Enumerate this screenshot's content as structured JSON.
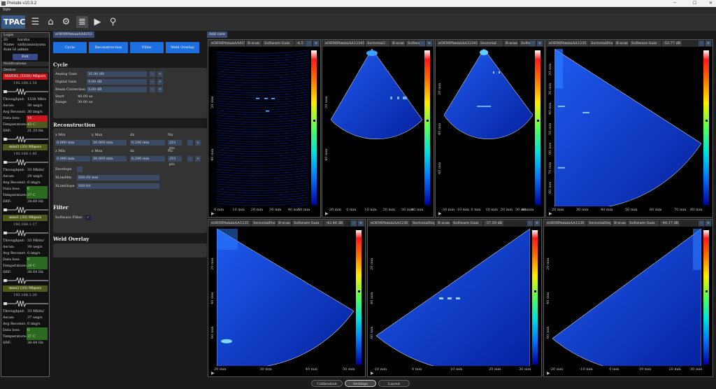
{
  "app": {
    "title": "Prelude v10.0.2",
    "style_menu": "Style"
  },
  "toolbar": {
    "logo": "TPAC",
    "icons": [
      "menu-icon",
      "home-icon",
      "gear-icon",
      "sliders-icon",
      "play-icon",
      "search-icon"
    ]
  },
  "login": {
    "header": "Login",
    "rows": [
      [
        "ID",
        "harsha"
      ],
      [
        "Name",
        "sathyanarayana"
      ],
      [
        "Role Id",
        "admin"
      ]
    ],
    "exit": "Exit",
    "notifications": "Notifications",
    "device": "Device"
  },
  "devices": [
    {
      "name": "MAXNL (5330) Mbps/s",
      "ip": "192.168.1.18",
      "color": "#c8161d",
      "stats": [
        [
          "Throughput:",
          "1538 Mb/s"
        ],
        [
          "Ascan:",
          "30 ueg/s"
        ],
        [
          "Avg Reconst:",
          "30 img/s"
        ],
        [
          "Data loss:",
          "16"
        ],
        [
          "Temperature:",
          "43 C"
        ],
        [
          "SRF:",
          "31.33 Hz"
        ]
      ]
    },
    {
      "name": "mini3 (33) Mbps/s",
      "ip": "192.168.1.45",
      "color": "#4d5a1c",
      "stats": [
        [
          "Throughput:",
          "33 Mbits/"
        ],
        [
          "Ascan:",
          "29 ueg/s"
        ],
        [
          "Avg Reconst:",
          "0 img/s"
        ],
        [
          "Data loss:",
          "0"
        ],
        [
          "Temperature:",
          "37 C"
        ],
        [
          "SRF:",
          "28.69 Hz"
        ]
      ]
    },
    {
      "name": "mini1 (33) Mbps/s",
      "ip": "192.168.1.17",
      "color": "#4d5a1c",
      "stats": [
        [
          "Throughput:",
          "33 Mbits/"
        ],
        [
          "Ascan:",
          "39 ueg/s"
        ],
        [
          "Avg Reconst:",
          "0 img/s"
        ],
        [
          "Data loss:",
          "0"
        ],
        [
          "Temperature:",
          "28 C"
        ],
        [
          "SRF:",
          "38.04 Hz"
        ]
      ]
    },
    {
      "name": "mini2 (33) Mbps/s",
      "ip": "192.168.1.20",
      "color": "#4d5a1c",
      "stats": [
        [
          "Throughput:",
          "33 Mbits/"
        ],
        [
          "Ascan:",
          "37 ueg/s"
        ],
        [
          "Avg Reconst:",
          "0 img/s"
        ],
        [
          "Data loss:",
          "0"
        ],
        [
          "Temperature:",
          "37 C"
        ],
        [
          "SRF:",
          "38.04 Hz"
        ]
      ]
    }
  ],
  "settings": {
    "device_tag": "eOEMPAmaxAA4353",
    "tabs": [
      "Cycle",
      "Reconstruction",
      "Filter",
      "Weld Overlay"
    ],
    "cycle": {
      "title": "Cycle",
      "analog_label": "Analog Gain",
      "analog": "35.00 dB",
      "digital_label": "Digital Gain",
      "digital": "0.00 dB",
      "beam_label": "Beam Correction",
      "beam": "0.00 dB",
      "start_label": "Start",
      "start": "40.00 us",
      "range_label": "Range",
      "range": "30.00 us"
    },
    "recon": {
      "title": "Reconstruction",
      "h1": [
        "x Min",
        "x Max",
        "dx",
        "Nx"
      ],
      "r1": [
        "0.000 mm",
        "50.000 mm",
        "0.200 mm",
        "251 pts"
      ],
      "h2": [
        "z Min",
        "z Max",
        "dz",
        "Nz"
      ],
      "r2": [
        "0.000 mm",
        "50.000 mm",
        "0.200 mm",
        "251 pts"
      ],
      "env_label": "Envelope",
      "xlimmin_label": "XLimMin",
      "xlimmin": "500.00 mm",
      "xlimslope_label": "XLimSlope",
      "xlimslope": "500.00"
    },
    "filter": {
      "title": "Filter",
      "sw_label": "Software Filter",
      "check": "✔"
    },
    "weld": {
      "title": "Weld Overlay"
    }
  },
  "add_view": "Add view",
  "views": [
    {
      "dev": "eOEMPAmaxAA4353",
      "mode": "B-scan",
      "gain_label": "Software Gain",
      "gain": "-4.5",
      "xt": [
        "0 mm",
        "10 mm",
        "20 mm",
        "30 mm",
        "40 mm",
        "50 mm"
      ],
      "yt": [
        "20 mm",
        "40 mm"
      ]
    },
    {
      "dev": "eOEMPAminiAA12345",
      "mode": "Sectorial2",
      "mode2": "B-scan",
      "gain_label": "Software Gai",
      "xt": [
        "-20 mm",
        "0 mm",
        "10 mm",
        "20 mm",
        "30 mm",
        "40 mm"
      ],
      "yt": [
        "20 mm",
        "40 mm"
      ]
    },
    {
      "dev": "eOEMPAminiAA12345",
      "mode": "Sectorial",
      "mode2": "B-scan",
      "gain_label": "Software",
      "xt": [
        "-30 mm",
        "-10 mm",
        "0 mm",
        "10 mm",
        "20 mm",
        "30 mm",
        "40 mm"
      ],
      "yt": [
        "20 mm",
        "40 mm",
        "60 mm"
      ]
    },
    {
      "dev": "eOEMPAminiAA1235",
      "mode": "SectorialPos",
      "mode2": "B-scan",
      "gain_label": "Software Gain",
      "gain": "-52.77 dB",
      "xt": [
        "20 mm",
        "30 mm",
        "40 mm",
        "50 mm",
        "60 mm",
        "70 mm",
        "80 mm"
      ],
      "yt": [
        "20 mm",
        "30 mm",
        "40 mm",
        "50 mm",
        "60 mm",
        "70 mm",
        "80 mm"
      ]
    },
    {
      "dev": "eOEMPAminiAA1235",
      "mode": "SectorialPos2",
      "mode2": "B-scan",
      "gain_label": "Software Gain",
      "gain": "-42.46 dB",
      "xt": [
        "20 mm",
        "30 mm",
        "40 mm",
        "50 mm"
      ],
      "yt": [
        "20 mm",
        "40 mm",
        "60 mm"
      ]
    },
    {
      "dev": "eOEMPAminiAA1236",
      "mode": "SectorialNeg2",
      "mode2": "B-scan",
      "gain_label": "Software Gain",
      "gain": "-37.59 dB",
      "xt": [
        "-10 mm",
        "0 mm",
        "10 mm",
        "20 mm",
        "30 mm"
      ],
      "yt": [
        "20 mm",
        "40 mm",
        "60 mm"
      ]
    },
    {
      "dev": "eOEMPAminiAA1236",
      "mode": "SectorialNeg",
      "mode2": "B-scan",
      "gain_label": "Software Gain",
      "gain": "-44.17 dB",
      "xt": [
        "-20 mm",
        "-10 mm",
        "0 mm",
        "10 mm",
        "20 mm",
        "30 mm"
      ],
      "yt": [
        "20 mm",
        "40 mm",
        "60 mm"
      ]
    }
  ],
  "bottom": {
    "calibration": "Calibration",
    "settings": "Settings",
    "layout": "Layout"
  },
  "colors": {
    "accent": "#1e6fe0",
    "scan_blue": "#0a2fd0",
    "alarm_red": "#c8161d",
    "ok_green": "#2d6a21"
  }
}
